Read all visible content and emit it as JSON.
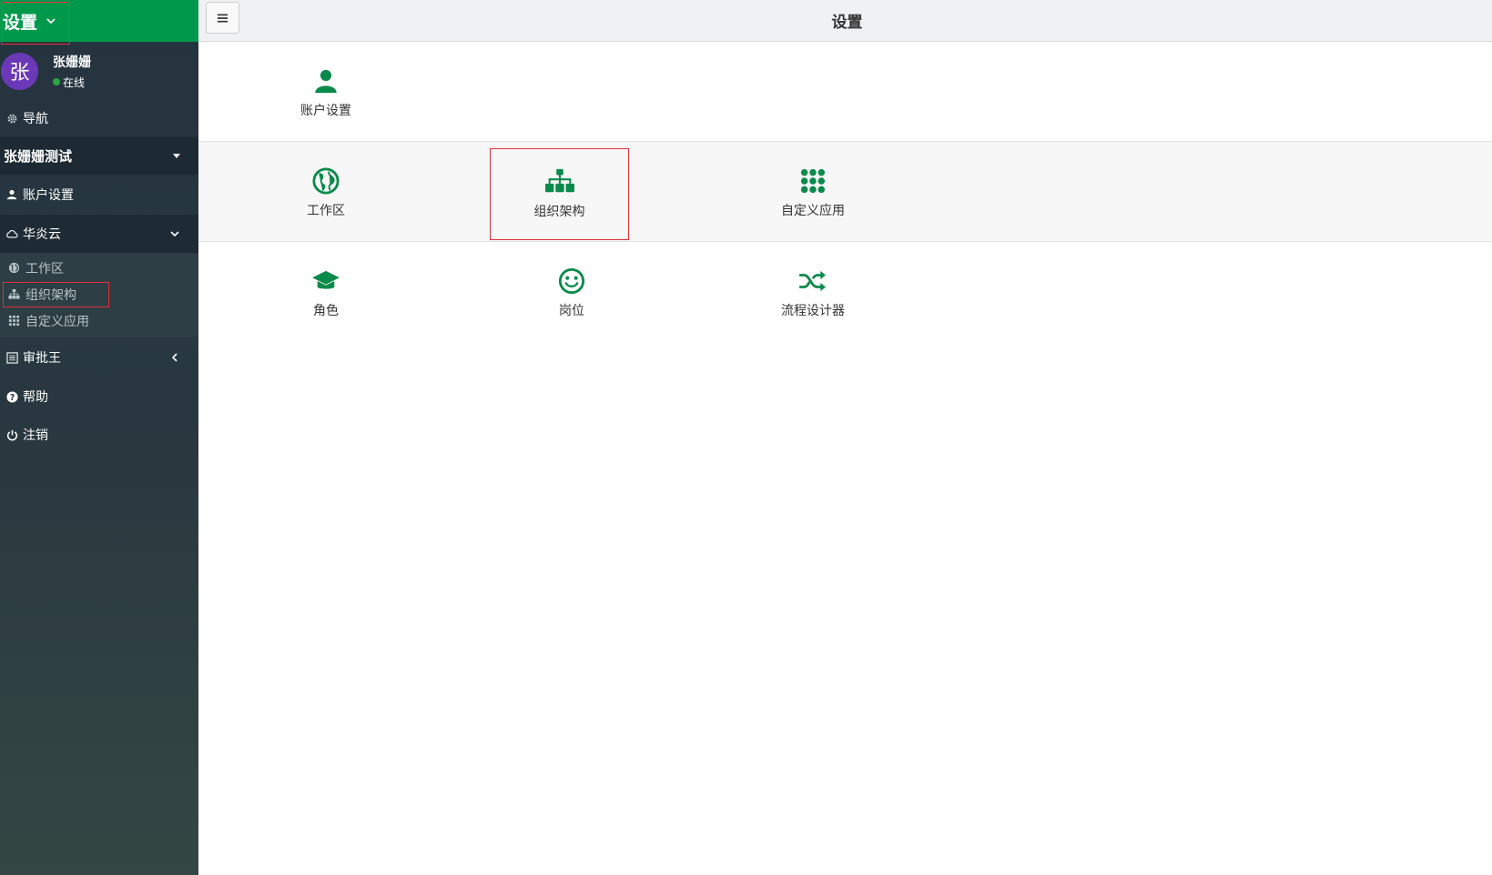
{
  "brand": {
    "title": "设置"
  },
  "user": {
    "avatar_char": "张",
    "name": "张姗姗",
    "status": "在线"
  },
  "sidebar": {
    "nav_label": "导航",
    "company": "张姗姗测试",
    "account": "账户设置",
    "cloud": {
      "label": "华炎云",
      "children": [
        "工作区",
        "组织架构",
        "自定义应用"
      ]
    },
    "approval": "审批王",
    "help": "帮助",
    "logout": "注销"
  },
  "topbar": {
    "title": "设置"
  },
  "tiles": {
    "account": "账户设置",
    "workspace": "工作区",
    "org": "组织架构",
    "custom_app": "自定义应用",
    "role": "角色",
    "position": "岗位",
    "flow": "流程设计器"
  },
  "colors": {
    "brand": "#00994c",
    "icon": "#0a8a4a",
    "highlight": "#e0303a",
    "sidebar": "#24333f"
  }
}
